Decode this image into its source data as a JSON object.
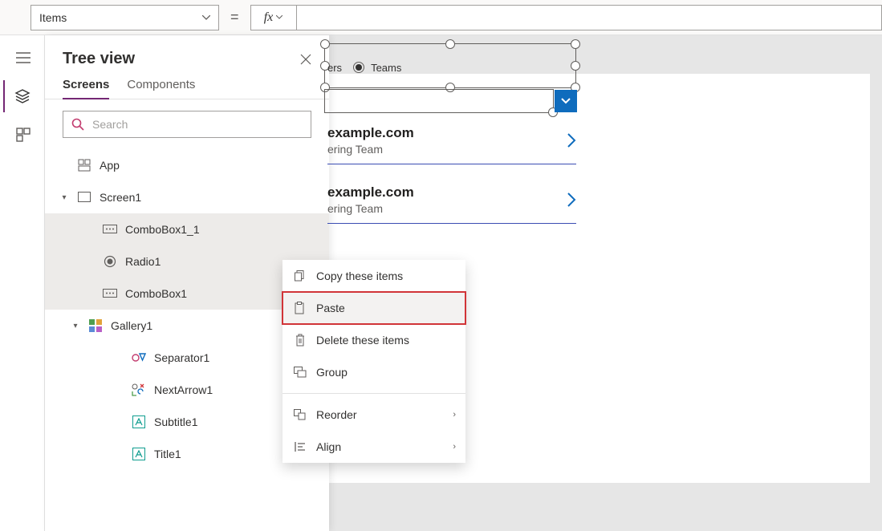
{
  "formula": {
    "property": "Items",
    "equals": "="
  },
  "panel": {
    "title": "Tree view",
    "tab_screens": "Screens",
    "tab_components": "Components",
    "search_placeholder": "Search"
  },
  "tree": {
    "app": "App",
    "screen1": "Screen1",
    "combobox1_1": "ComboBox1_1",
    "radio1": "Radio1",
    "combobox1": "ComboBox1",
    "gallery1": "Gallery1",
    "separator1": "Separator1",
    "nextarrow1": "NextArrow1",
    "subtitle1": "Subtitle1",
    "title1": "Title1"
  },
  "radio": {
    "opt1": "ers",
    "opt2": "Teams"
  },
  "gallery": {
    "row1": {
      "title": "example.com",
      "subtitle": "ering Team"
    },
    "row2": {
      "title": "example.com",
      "subtitle": "ering Team"
    }
  },
  "ctx": {
    "copy": "Copy these items",
    "paste": "Paste",
    "delete": "Delete these items",
    "group": "Group",
    "reorder": "Reorder",
    "align": "Align"
  }
}
